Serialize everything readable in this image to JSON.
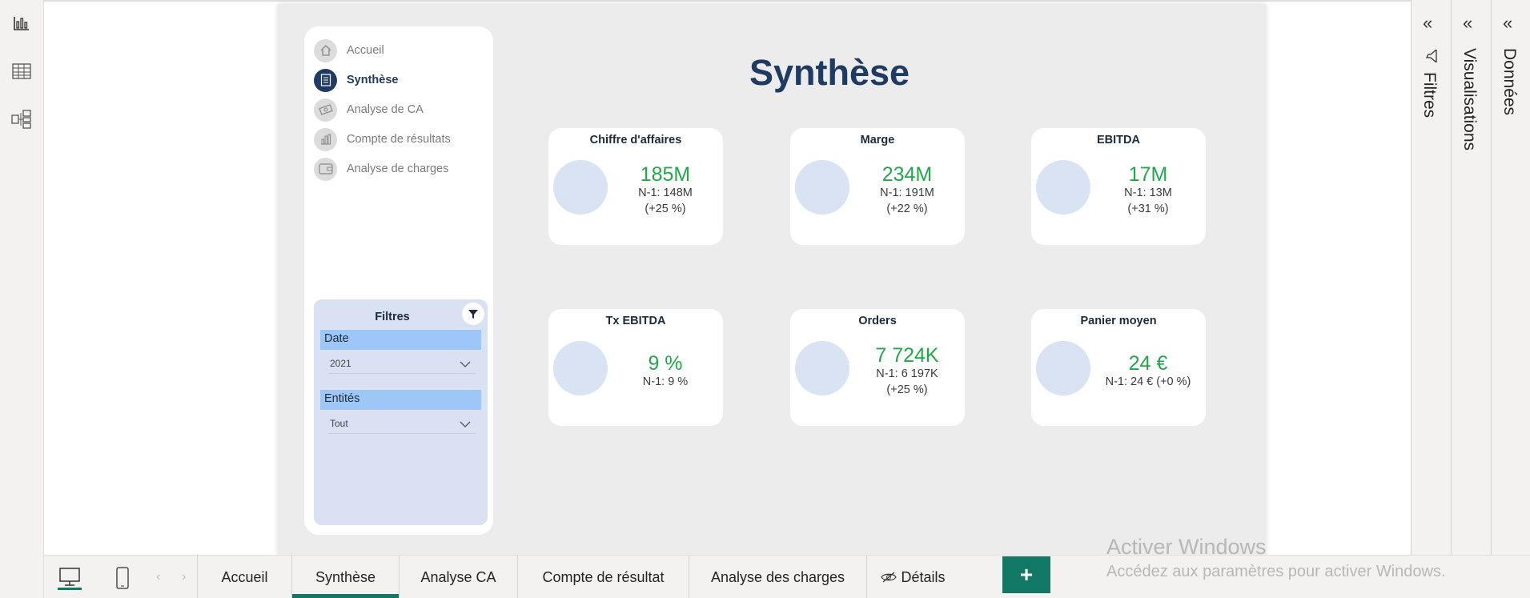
{
  "nav": {
    "items": [
      {
        "label": "Accueil",
        "icon": "home-icon"
      },
      {
        "label": "Synthèse",
        "icon": "document-icon",
        "active": true
      },
      {
        "label": "Analyse de CA",
        "icon": "money-icon"
      },
      {
        "label": "Compte de résultats",
        "icon": "bar-chart-icon"
      },
      {
        "label": "Analyse de charges",
        "icon": "wallet-icon"
      }
    ]
  },
  "filters": {
    "title": "Filtres",
    "date_label": "Date",
    "date_value": "2021",
    "entity_label": "Entités",
    "entity_value": "Tout"
  },
  "page_title": "Synthèse",
  "cards": [
    {
      "title": "Chiffre d'affaires",
      "value": "185M",
      "sub1": "N-1: 148M",
      "sub2": "(+25 %)"
    },
    {
      "title": "Marge",
      "value": "234M",
      "sub1": "N-1: 191M",
      "sub2": "(+22 %)"
    },
    {
      "title": "EBITDA",
      "value": "17M",
      "sub1": "N-1: 13M",
      "sub2": "(+31 %)"
    },
    {
      "title": "Tx EBITDA",
      "value": "9 %",
      "sub1": "N-1: 9 %",
      "sub2": ""
    },
    {
      "title": "Orders",
      "value": "7 724K",
      "sub1": "N-1: 6 197K",
      "sub2": "(+25 %)"
    },
    {
      "title": "Panier moyen",
      "value": "24 €",
      "sub1": "N-1: 24 € (+0 %)",
      "sub2": ""
    }
  ],
  "panes": {
    "filters": "Filtres",
    "visualizations": "Visualisations",
    "data": "Données"
  },
  "tabs": [
    {
      "label": "Accueil"
    },
    {
      "label": "Synthèse",
      "active": true
    },
    {
      "label": "Analyse CA"
    },
    {
      "label": "Compte de résultat"
    },
    {
      "label": "Analyse des charges"
    },
    {
      "label": "Détails",
      "hidden": true
    }
  ],
  "add_tab": "+",
  "watermark": {
    "line1": "Activer Windows",
    "line2": "Accédez aux paramètres pour activer Windows."
  },
  "colors": {
    "accent": "#117865",
    "navy": "#1f3a63",
    "kpi_green": "#22a84a",
    "card_circle": "#d9e3f3",
    "filter_bg": "#d9e1f2",
    "slicer_header": "#9ec7f7"
  }
}
